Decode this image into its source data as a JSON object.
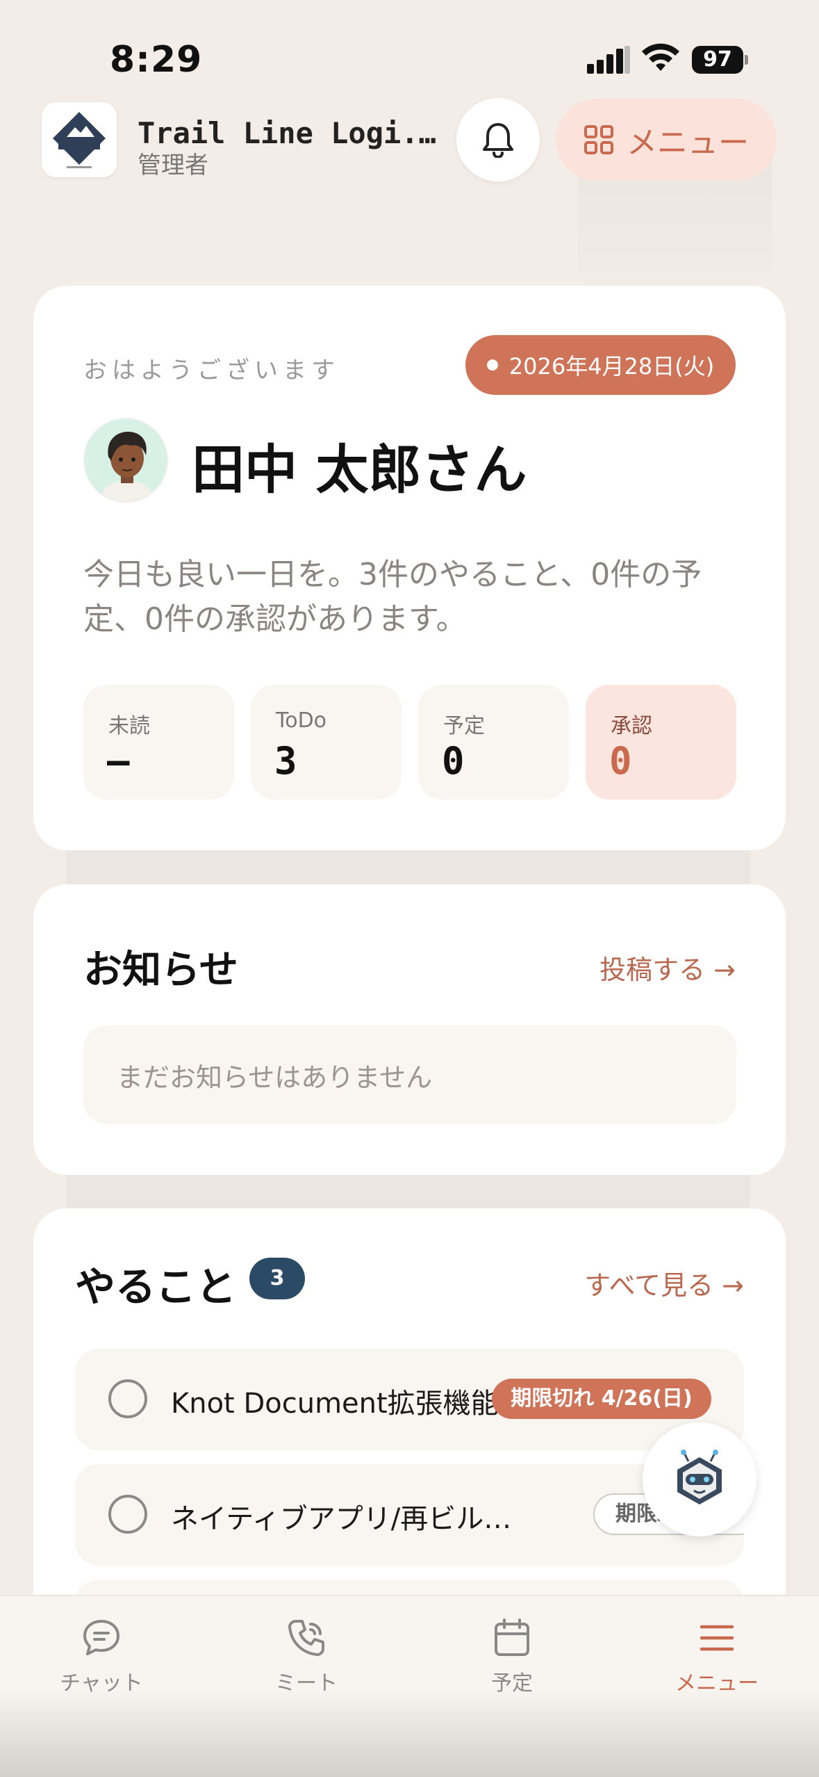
{
  "status_bar": {
    "time": "8:29",
    "battery": "97"
  },
  "header": {
    "company": "Trail Line Logi.株式会社",
    "role": "管理者",
    "logo_text": "Trail Line Logi.",
    "menu_label": "メニュー",
    "bell_icon": "bell-icon",
    "menu_icon": "grid-icon"
  },
  "greeting_card": {
    "greeting": "おはようございます",
    "date": "2026年4月28日(火)",
    "name": "田中 太郎さん",
    "summary": "今日も良い一日を。3件のやること、0件の予定、0件の承認があります。",
    "stats": [
      {
        "label": "未読",
        "value": "–"
      },
      {
        "label": "ToDo",
        "value": "3"
      },
      {
        "label": "予定",
        "value": "0"
      },
      {
        "label": "承認",
        "value": "0"
      }
    ]
  },
  "notices": {
    "title": "お知らせ",
    "post_link": "投稿する →",
    "empty": "まだお知らせはありません"
  },
  "todos": {
    "title": "やること",
    "count": "3",
    "see_all": "すべて見る →",
    "items": [
      {
        "text": "Knot Document拡張機能",
        "badge": "期限切れ 4/26(日)"
      },
      {
        "text": "ネイティブアプリ/再ビル…",
        "badge": "期限未設定"
      }
    ]
  },
  "tabbar": {
    "tabs": [
      {
        "label": "チャット",
        "icon": "chat-icon"
      },
      {
        "label": "ミート",
        "icon": "phone-icon"
      },
      {
        "label": "予定",
        "icon": "calendar-icon"
      },
      {
        "label": "メニュー",
        "icon": "menu-icon"
      }
    ]
  },
  "colors": {
    "background": "#F4ECE6",
    "accent": "#CF7458",
    "accent_text": "#C9694D",
    "badge_navy": "#2B4A66"
  }
}
